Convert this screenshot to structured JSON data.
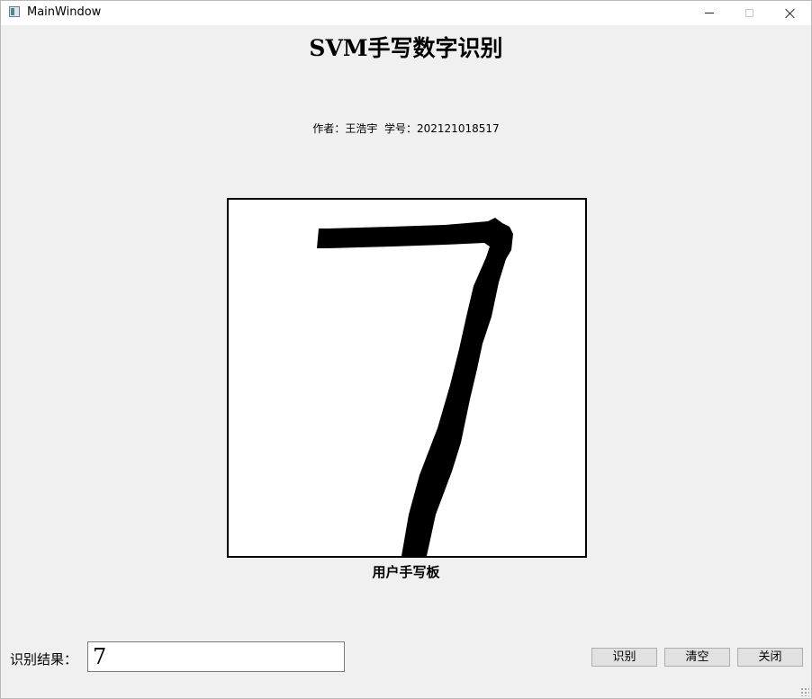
{
  "window": {
    "title": "MainWindow"
  },
  "header": {
    "title": "SVM手写数字识别",
    "author_line": "作者：王浩宇  学号：202121018517"
  },
  "canvas": {
    "caption": "用户手写板"
  },
  "result": {
    "label": "识别结果：",
    "value": "7"
  },
  "buttons": {
    "recognize": "识别",
    "clear": "清空",
    "close": "关闭"
  },
  "icons": {
    "app": "window-app-icon",
    "minimize": "minimize-icon",
    "maximize": "maximize-icon",
    "close": "close-icon"
  }
}
